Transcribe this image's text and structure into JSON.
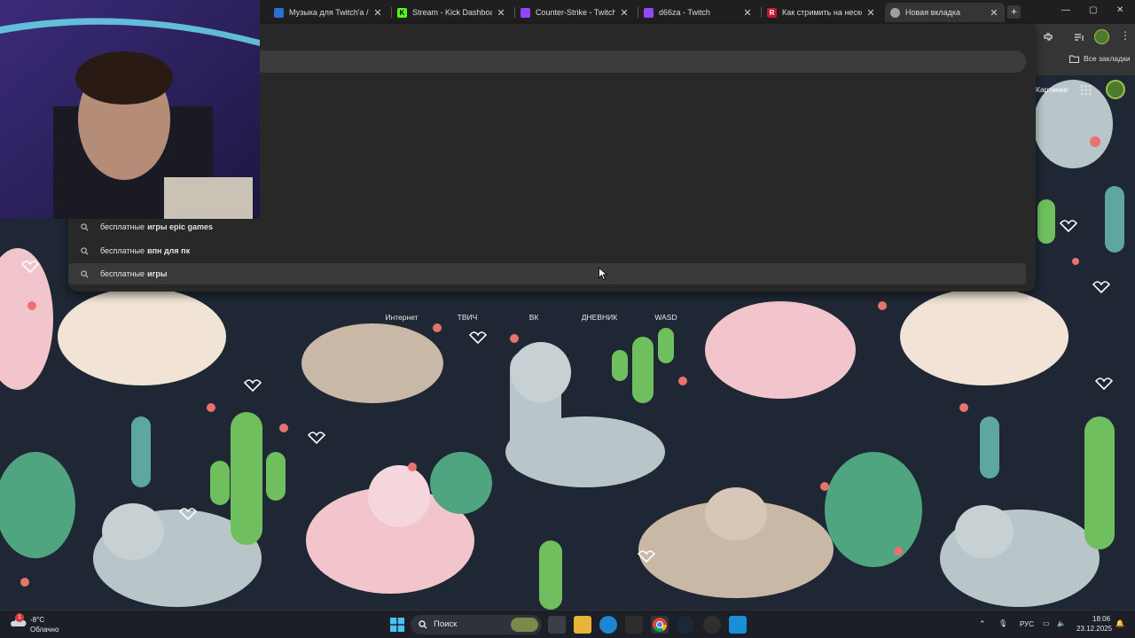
{
  "tabs": [
    {
      "title": "Музыка для Twitch'a / бе",
      "favicon_color": "#2b6fd6",
      "favicon_glyph": "II"
    },
    {
      "title": "Stream - Kick Dashboard",
      "favicon_color": "#53fc18",
      "favicon_glyph": "K"
    },
    {
      "title": "Counter-Strike - Twitch",
      "favicon_color": "#9146ff",
      "favicon_glyph": ""
    },
    {
      "title": "d66za - Twitch",
      "favicon_color": "#9146ff",
      "favicon_glyph": ""
    },
    {
      "title": "Как стримить на неско",
      "favicon_color": "#c0192e",
      "favicon_glyph": "R"
    },
    {
      "title": "Новая вкладка",
      "favicon_color": "#9aa0a6",
      "favicon_glyph": ""
    }
  ],
  "window_controls": {
    "minimize": "—",
    "maximize": "▢",
    "close": "✕"
  },
  "bookmarks": {
    "all_bookmarks": "Все закладки"
  },
  "new_tab_page": {
    "pictures_link": "Картинки"
  },
  "suggestions": [
    {
      "prefix": "бесплатные",
      "completion": "игры epic games"
    },
    {
      "prefix": "бесплатные",
      "completion": "впн для пк"
    },
    {
      "prefix": "бесплатные",
      "completion": "игры"
    }
  ],
  "shortcuts": [
    "Интернет",
    "ТВИЧ",
    "ВК",
    "ДНЕВНИК",
    "WASD"
  ],
  "taskbar": {
    "weather_temp": "-8°C",
    "weather_desc": "Облачно",
    "weather_badge": "1",
    "search_label": "Поиск",
    "language": "РУС",
    "time": "18:06",
    "date": "23.12.2025"
  },
  "colors": {
    "wallpaper_bg": "#1e2733",
    "chrome_dark": "#1f1f1f",
    "chrome_toolbar": "#353535",
    "omnibox_panel": "#282828",
    "taskbar_bg": "#1c1f26"
  }
}
